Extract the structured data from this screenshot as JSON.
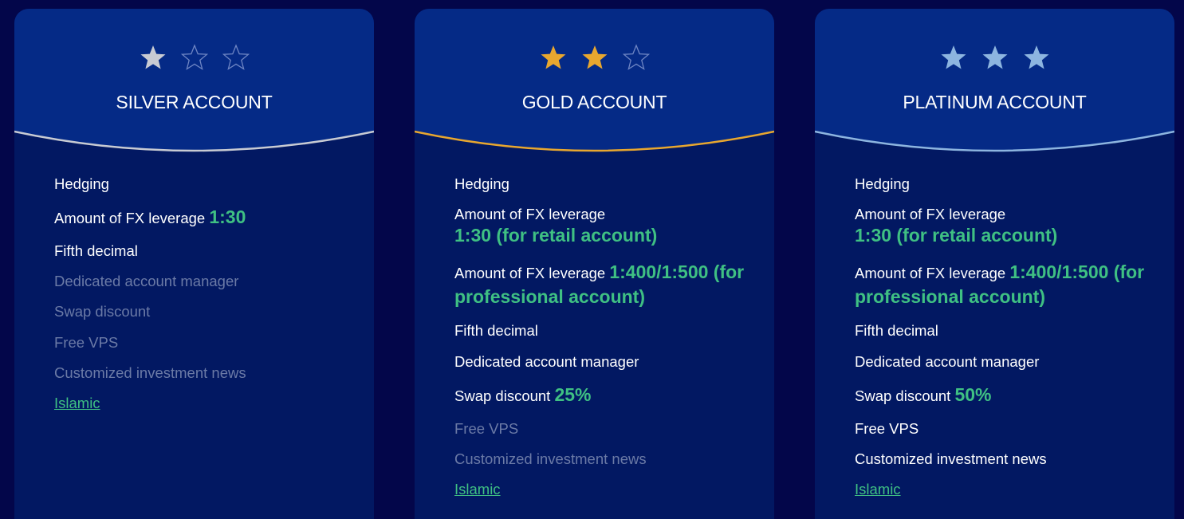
{
  "colors": {
    "page_bg": "#03064a",
    "card_bg": "#021862",
    "header_bg": "#052a86",
    "value_green": "#3fc083",
    "disabled_text": "#6b7aa6",
    "star_silver": "#c8cbd3",
    "star_gold": "#e8a72f",
    "star_platinum": "#8db5e0",
    "empty_star_outline": "#6f86c4"
  },
  "cards": [
    {
      "title": "SILVER ACCOUNT",
      "rating": 1,
      "max_rating": 3,
      "star_color": "#c8cbd3",
      "curve_color": "#c8cbd3",
      "features": [
        {
          "label": "Hedging",
          "value": "",
          "enabled": true
        },
        {
          "label": "Amount of FX leverage",
          "value": "1:30",
          "enabled": true
        },
        {
          "label": "Fifth decimal",
          "value": "",
          "enabled": true
        },
        {
          "label": "Dedicated account manager",
          "value": "",
          "enabled": false
        },
        {
          "label": "Swap discount",
          "value": "",
          "enabled": false
        },
        {
          "label": "Free VPS",
          "value": "",
          "enabled": false
        },
        {
          "label": "Customized investment news",
          "value": "",
          "enabled": false
        }
      ],
      "islamic_link": "Islamic"
    },
    {
      "title": "GOLD ACCOUNT",
      "rating": 2,
      "max_rating": 3,
      "star_color": "#e8a72f",
      "curve_color": "#e8a72f",
      "features": [
        {
          "label": "Hedging",
          "value": "",
          "enabled": true
        },
        {
          "label": "Amount of FX leverage",
          "value": "1:30 (for retail account)",
          "enabled": true,
          "value_block": true
        },
        {
          "label": "Amount of FX leverage",
          "value": "1:400/1:500 (for professional account)",
          "enabled": true
        },
        {
          "label": "Fifth decimal",
          "value": "",
          "enabled": true
        },
        {
          "label": "Dedicated account manager",
          "value": "",
          "enabled": true
        },
        {
          "label": "Swap discount",
          "value": "25%",
          "enabled": true
        },
        {
          "label": "Free VPS",
          "value": "",
          "enabled": false
        },
        {
          "label": "Customized investment news",
          "value": "",
          "enabled": false
        }
      ],
      "islamic_link": "Islamic"
    },
    {
      "title": "PLATINUM ACCOUNT",
      "rating": 3,
      "max_rating": 3,
      "star_color": "#8db5e0",
      "curve_color": "#8db5e0",
      "features": [
        {
          "label": "Hedging",
          "value": "",
          "enabled": true
        },
        {
          "label": "Amount of FX leverage",
          "value": "1:30 (for retail account)",
          "enabled": true,
          "value_block": true
        },
        {
          "label": "Amount of FX leverage",
          "value": "1:400/1:500 (for professional account)",
          "enabled": true
        },
        {
          "label": "Fifth decimal",
          "value": "",
          "enabled": true
        },
        {
          "label": "Dedicated account manager",
          "value": "",
          "enabled": true
        },
        {
          "label": "Swap discount",
          "value": "50%",
          "enabled": true
        },
        {
          "label": "Free VPS",
          "value": "",
          "enabled": true
        },
        {
          "label": "Customized investment news",
          "value": "",
          "enabled": true
        }
      ],
      "islamic_link": "Islamic"
    }
  ]
}
